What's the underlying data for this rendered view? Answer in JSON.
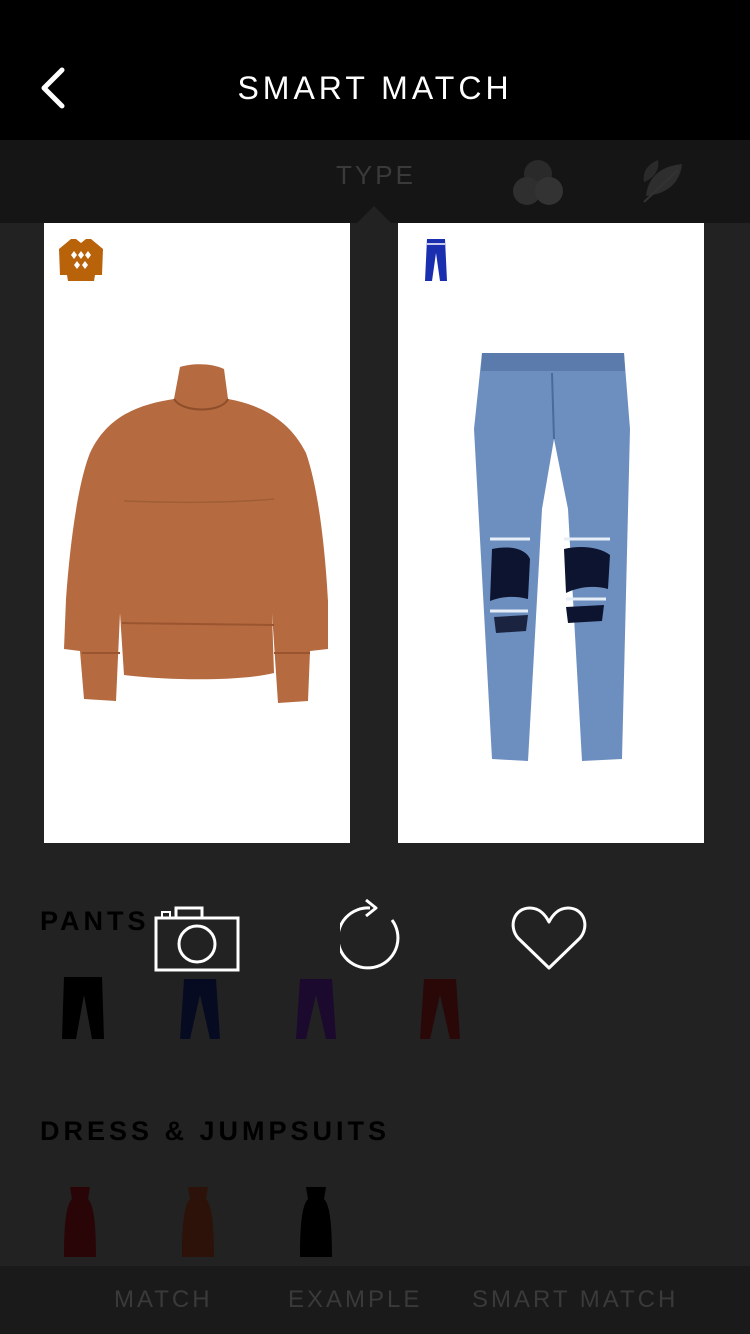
{
  "header": {
    "title": "SMART MATCH"
  },
  "filters": {
    "type_label": "TYPE"
  },
  "sections": {
    "pants_title": "PANTS",
    "dress_title": "DRESS & JUMPSUITS"
  },
  "bottom_nav": {
    "match": "MATCH",
    "example": "EXAMPLE",
    "smart_match": "SMART MATCH"
  },
  "colors": {
    "sweater": "#b56a3f",
    "jeans": "#6d8fbf",
    "badge_sweater": "#b8620a",
    "badge_jeans": "#1a2fb0"
  }
}
